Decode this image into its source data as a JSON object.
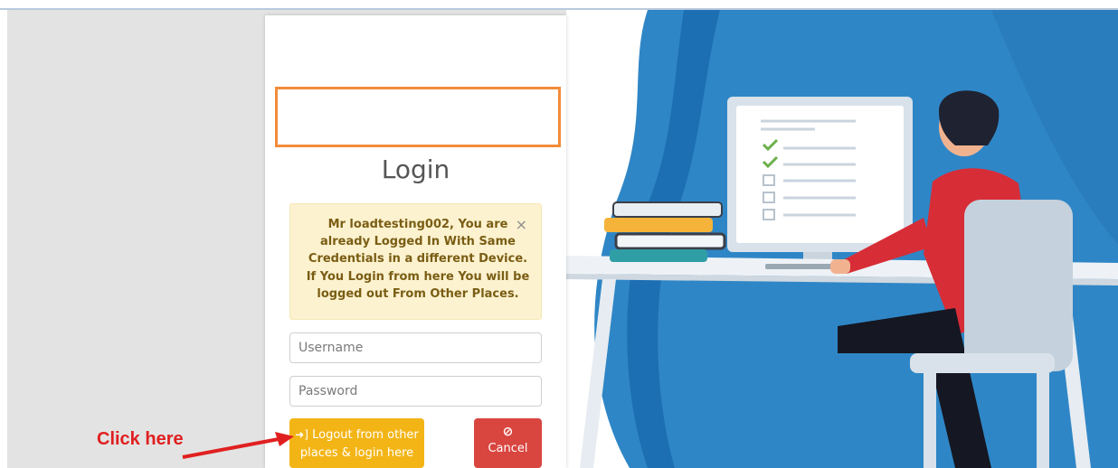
{
  "login": {
    "title": "Login",
    "alert_message": "Mr loadtesting002, You are already Logged In With Same Credentials in a different Device. If You Login from here You will be logged out From Other Places.",
    "alert_close": "×",
    "username_placeholder": "Username",
    "password_placeholder": "Password",
    "logout_button_label": "Logout from other places & login here",
    "cancel_button_label": "Cancel"
  },
  "annotation": {
    "click_here": "Click here",
    "color": "#e02020"
  },
  "icons": {
    "logout_icon": "sign-in-icon",
    "cancel_icon": "ban-icon",
    "logout_glyph": "➜]",
    "cancel_glyph": "⊘"
  },
  "colors": {
    "logo_border": "#f28c3a",
    "alert_bg": "#fcf2cf",
    "logout_button": "#f3b516",
    "cancel_button": "#d9453f",
    "hero_blue": "#2f86c6"
  }
}
